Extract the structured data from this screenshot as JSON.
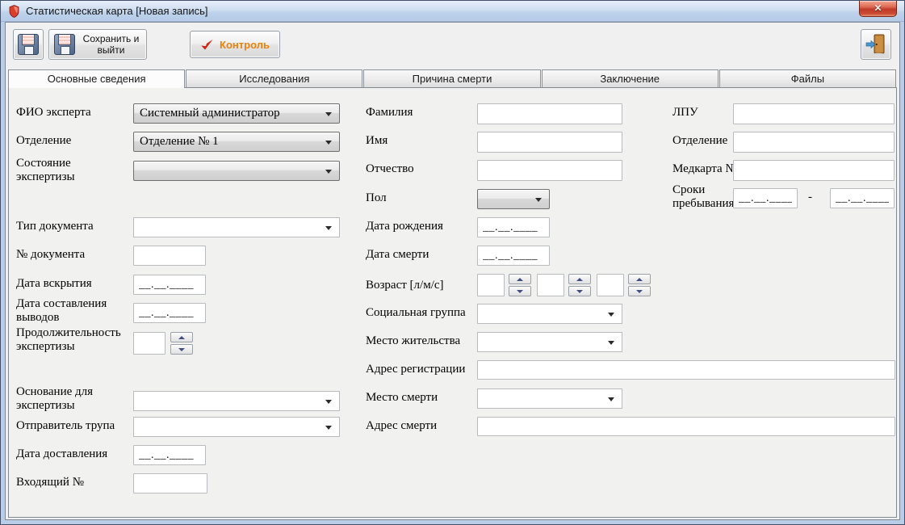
{
  "window": {
    "title": "Статистическая карта [Новая запись]"
  },
  "icons": {
    "app_icon": "red-shield",
    "save_icon": "floppy-disk",
    "control_icon": "red-checkmark",
    "exit_icon": "door-with-blue-arrow",
    "close_glyph": "✕"
  },
  "toolbar": {
    "save_exit_label": "Сохранить и выйти",
    "control_label": "Контроль"
  },
  "tabs": {
    "items": [
      {
        "label": "Основные сведения",
        "active": true
      },
      {
        "label": "Исследования",
        "active": false
      },
      {
        "label": "Причина смерти",
        "active": false
      },
      {
        "label": "Заключение",
        "active": false
      },
      {
        "label": "Файлы",
        "active": false
      }
    ]
  },
  "form": {
    "date_mask": "__.__.____",
    "range_separator": "-",
    "left": {
      "expert": {
        "label": "ФИО эксперта",
        "value": "Системный администратор"
      },
      "department": {
        "label": "Отделение",
        "value": "Отделение № 1"
      },
      "state": {
        "label": "Состояние экспертизы",
        "value": ""
      },
      "doc_type": {
        "label": "Тип документа",
        "value": ""
      },
      "doc_number": {
        "label": "№ документа",
        "value": ""
      },
      "autopsy_date": {
        "label": "Дата вскрытия"
      },
      "conclusions_date": {
        "label": "Дата составления выводов"
      },
      "duration": {
        "label": "Продолжительность экспертизы",
        "value": ""
      },
      "basis": {
        "label": "Основание для экспертизы",
        "value": ""
      },
      "sender": {
        "label": "Отправитель трупа",
        "value": ""
      },
      "delivery_date": {
        "label": "Дата доставления"
      },
      "incoming_number": {
        "label": "Входящий №",
        "value": ""
      }
    },
    "middle": {
      "surname": {
        "label": "Фамилия",
        "value": ""
      },
      "name": {
        "label": "Имя",
        "value": ""
      },
      "patronymic": {
        "label": "Отчество",
        "value": ""
      },
      "sex": {
        "label": "Пол",
        "value": ""
      },
      "birth_date": {
        "label": "Дата рождения"
      },
      "death_date": {
        "label": "Дата смерти"
      },
      "age": {
        "label": "Возраст [л/м/с]"
      },
      "social_group": {
        "label": "Социальная группа",
        "value": ""
      },
      "residence": {
        "label": "Место жительства",
        "value": ""
      },
      "registration_address": {
        "label": "Адрес регистрации",
        "value": ""
      },
      "death_place": {
        "label": "Место смерти",
        "value": ""
      },
      "death_address": {
        "label": "Адрес смерти",
        "value": ""
      }
    },
    "right": {
      "lpu": {
        "label": "ЛПУ",
        "value": ""
      },
      "department": {
        "label": "Отделение",
        "value": ""
      },
      "medcard": {
        "label": "Медкарта №",
        "value": ""
      },
      "stay_period": {
        "label": "Сроки пребывания"
      }
    }
  }
}
